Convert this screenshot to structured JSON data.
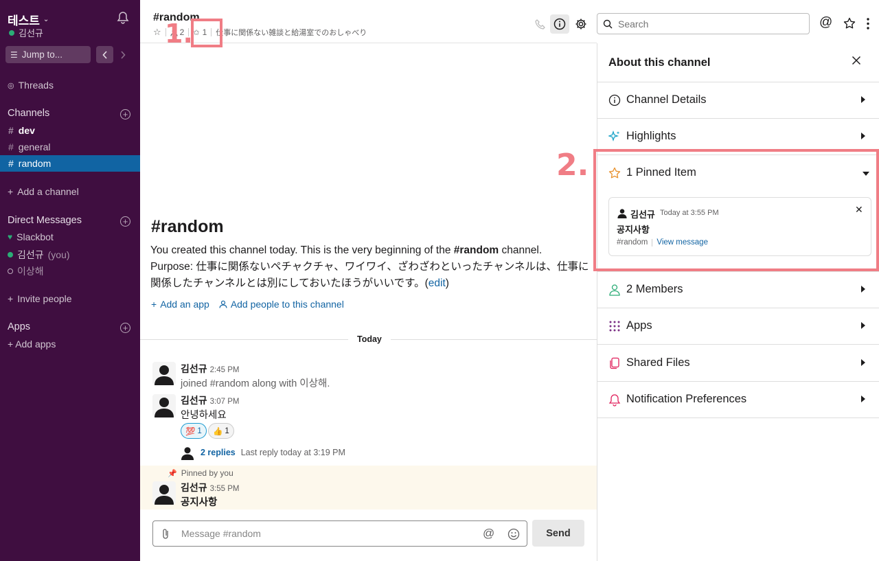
{
  "workspace": {
    "name": "테스트",
    "user": "김선규"
  },
  "sidebar": {
    "jump_to": "Jump to...",
    "threads": "Threads",
    "channels_heading": "Channels",
    "channels": [
      {
        "name": "dev",
        "bold": true
      },
      {
        "name": "general",
        "bold": false
      },
      {
        "name": "random",
        "active": true
      }
    ],
    "add_channel": "Add a channel",
    "dm_heading": "Direct Messages",
    "dms": [
      {
        "name": "Slackbot"
      },
      {
        "name": "김선규",
        "suffix": "(you)"
      },
      {
        "name": "이상해"
      }
    ],
    "invite_people": "Invite people",
    "apps_heading": "Apps",
    "add_apps": "Add apps"
  },
  "header": {
    "channel": "#random",
    "member_count": "2",
    "pin_count": "1",
    "topic": "仕事に関係ない雑談と給湯室でのおしゃべり",
    "search_placeholder": "Search"
  },
  "intro": {
    "title": "#random",
    "line1_pre": "You created this channel today. This is the very beginning of the ",
    "line1_channel": "#random",
    "line1_post": " channel.",
    "purpose": "Purpose: 仕事に関係ないペチャクチャ、ワイワイ、ざわざわといったチャンネルは、仕事に関係したチャンネルとは別にしておいたほうがいいです。(",
    "edit": "edit",
    "purpose_end": ")",
    "add_app": "Add an app",
    "add_people": "Add people to this channel"
  },
  "messages": {
    "day": "Today",
    "m1": {
      "name": "김선규",
      "time": "2:45 PM",
      "text": "joined #random along with 이상해."
    },
    "m2": {
      "name": "김선규",
      "time": "3:07 PM",
      "text": "안녕하세요",
      "reactions": [
        {
          "emoji": "💯",
          "count": "1"
        },
        {
          "emoji": "👍",
          "count": "1"
        }
      ],
      "replies": "2 replies",
      "last_reply": "Last reply today at 3:19 PM"
    },
    "pinned_by": "Pinned by you",
    "m3": {
      "name": "김선규",
      "time": "3:55 PM",
      "text": "공지사항"
    }
  },
  "composer": {
    "placeholder": "Message #random",
    "send": "Send"
  },
  "panel": {
    "title": "About this channel",
    "rows": {
      "details": "Channel Details",
      "highlights": "Highlights",
      "pinned": "1 Pinned Item",
      "members": "2 Members",
      "apps": "Apps",
      "files": "Shared Files",
      "notifications": "Notification Preferences"
    },
    "pin_card": {
      "name": "김선규",
      "time": "Today at 3:55 PM",
      "text": "공지사항",
      "channel": "#random",
      "view": "View message"
    }
  },
  "annotations": {
    "one": "1.",
    "two": "2."
  },
  "colors": {
    "sidebar": "#3f0e40",
    "active": "#1164a3",
    "annotation": "#f07d85",
    "link": "#1264a3"
  }
}
